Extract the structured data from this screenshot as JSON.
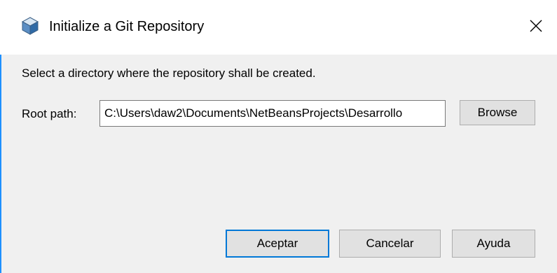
{
  "window": {
    "title": "Initialize a Git Repository",
    "icon": "netbeans-cube-icon",
    "accent_color": "#1e90ff"
  },
  "content": {
    "instruction": "Select a directory where the repository shall be created.",
    "root_path_label": "Root path:",
    "root_path_value": "C:\\Users\\daw2\\Documents\\NetBeansProjects\\Desarrollo"
  },
  "buttons": {
    "browse": "Browse",
    "ok": "Aceptar",
    "cancel": "Cancelar",
    "help": "Ayuda"
  },
  "colors": {
    "client_background": "#f0f0f0",
    "button_face": "#e1e1e1",
    "default_button_border": "#0078d7"
  }
}
